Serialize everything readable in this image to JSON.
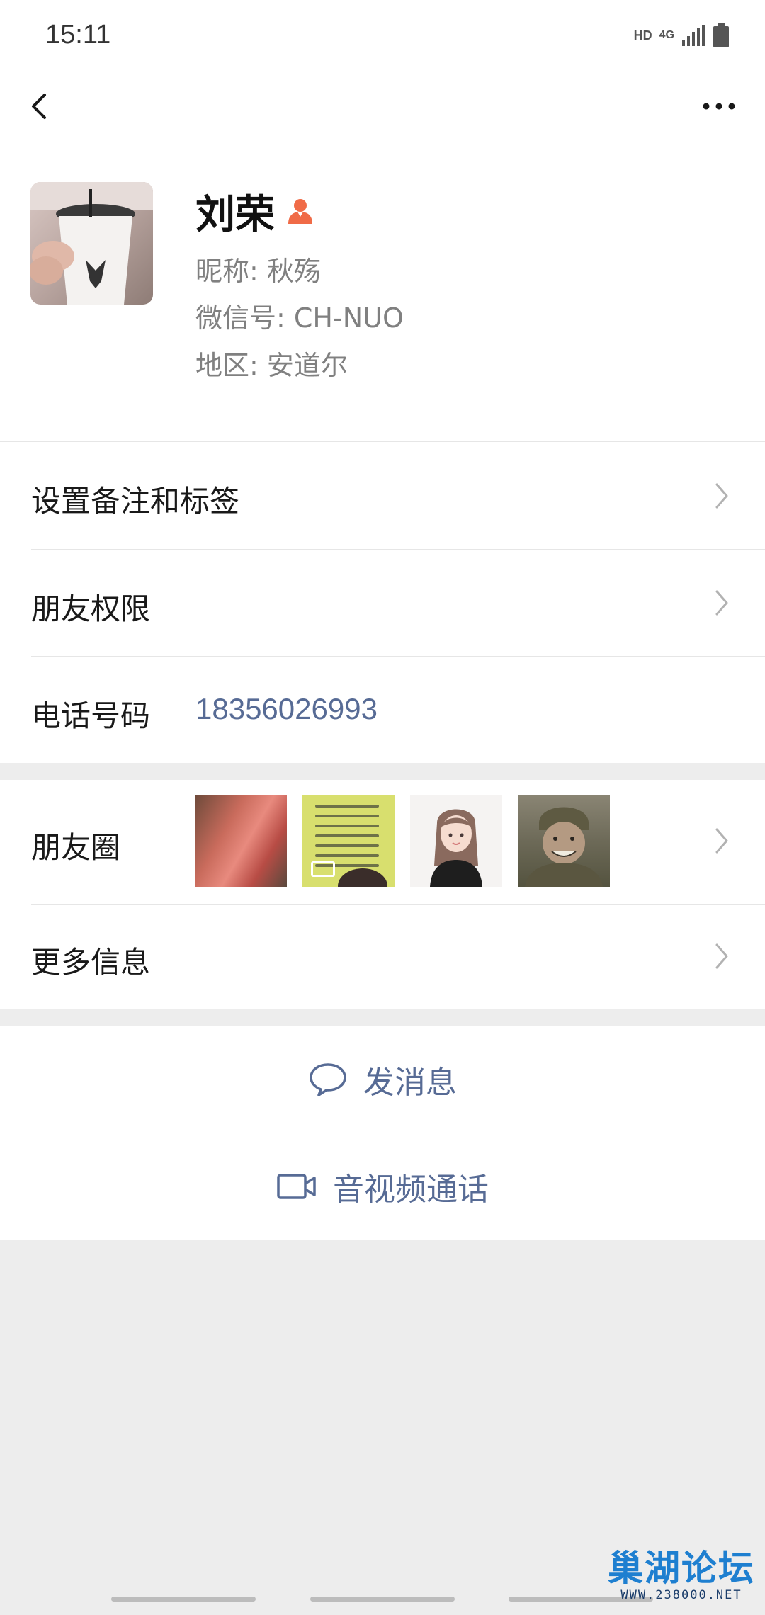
{
  "status_bar": {
    "time": "15:11",
    "hd": "HD",
    "network": "4G"
  },
  "nav": {
    "back_icon": "back-chevron-icon",
    "more_icon": "more-dots-icon"
  },
  "profile": {
    "name": "刘荣",
    "nickname": "昵称:  秋殇",
    "wechat_id": "微信号:  CH-NUO",
    "region": "地区:  安道尔"
  },
  "rows": {
    "remark_label": "设置备注和标签",
    "permission_label": "朋友权限",
    "phone_label": "电话号码",
    "phone_value": "18356026993",
    "moments_label": "朋友圈",
    "more_info_label": "更多信息"
  },
  "actions": {
    "send_message": "发消息",
    "video_call": "音视频通话"
  },
  "watermark": {
    "title": "巢湖论坛",
    "url": "WWW.238000.NET"
  },
  "colors": {
    "link": "#576b95",
    "background": "#ededed",
    "gender_icon": "#f06b47"
  }
}
